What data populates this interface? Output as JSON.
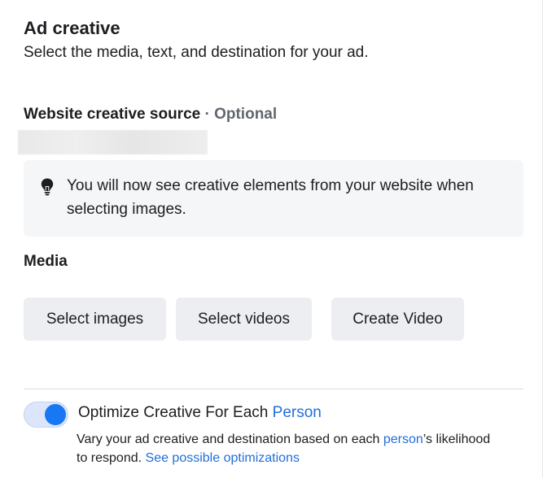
{
  "section": {
    "title": "Ad creative",
    "subtitle": "Select the media, text, and destination for your ad."
  },
  "website_source": {
    "label": "Website creative source",
    "separator": "·",
    "optional_label": "Optional"
  },
  "info_box": {
    "icon": "lightbulb-icon",
    "message": "You will now see creative elements from your website when selecting images."
  },
  "media": {
    "label": "Media",
    "buttons": {
      "select_images": "Select images",
      "select_videos": "Select videos",
      "create_video": "Create Video"
    }
  },
  "optimize": {
    "toggle_on": true,
    "title_prefix": "Optimize Creative For Each",
    "title_link": "Person",
    "desc_part1": "Vary your ad creative and destination based on each",
    "desc_link_person": "person",
    "desc_part2": "’s likelihood to respond.",
    "desc_link_optimizations": "See possible optimizations"
  },
  "colors": {
    "accent": "#1877f2",
    "link": "#216fdb",
    "button_bg": "#eceef1",
    "info_bg": "#f5f6f7"
  }
}
